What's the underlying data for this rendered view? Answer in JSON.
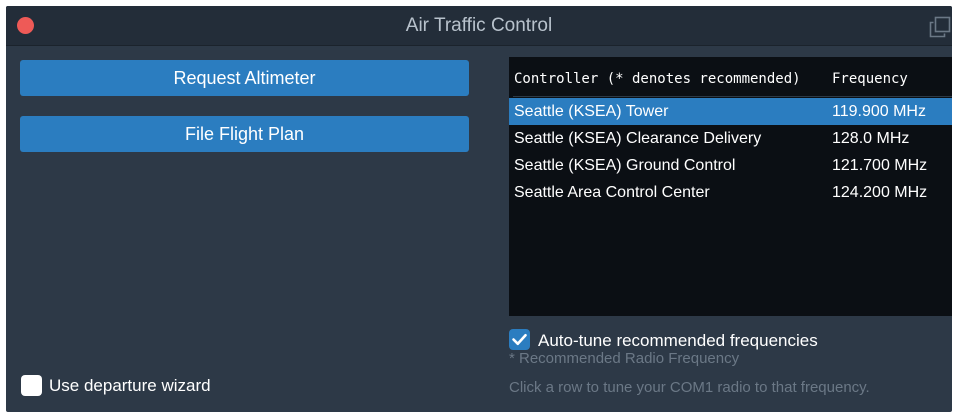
{
  "window": {
    "title": "Air Traffic Control",
    "close_icon": "close-icon",
    "popout_icon": "popout-window-icon"
  },
  "actions": {
    "request_altimeter": "Request Altimeter",
    "file_flight_plan": "File Flight Plan"
  },
  "departure_wizard": {
    "label": "Use departure wizard",
    "checked": false
  },
  "frequency_table": {
    "headers": {
      "controller": "Controller (* denotes recommended)",
      "frequency": "Frequency"
    },
    "rows": [
      {
        "controller": "Seattle (KSEA) Tower",
        "frequency": "119.900 MHz",
        "selected": true
      },
      {
        "controller": "Seattle (KSEA) Clearance Delivery",
        "frequency": "128.0 MHz",
        "selected": false
      },
      {
        "controller": "Seattle (KSEA) Ground Control",
        "frequency": "121.700 MHz",
        "selected": false
      },
      {
        "controller": "Seattle Area Control Center",
        "frequency": "124.200 MHz",
        "selected": false
      }
    ]
  },
  "auto_tune": {
    "label": "Auto-tune recommended frequencies",
    "checked": true,
    "note": "* Recommended Radio Frequency"
  },
  "hint": "Click a row to tune your COM1 radio to that frequency.",
  "colors": {
    "window_bg": "#2d3947",
    "titlebar_bg": "#232d39",
    "accent": "#2b7dc0",
    "close_red": "#ee5a57",
    "table_bg": "#0b0f14",
    "muted_text": "#6b7886"
  }
}
